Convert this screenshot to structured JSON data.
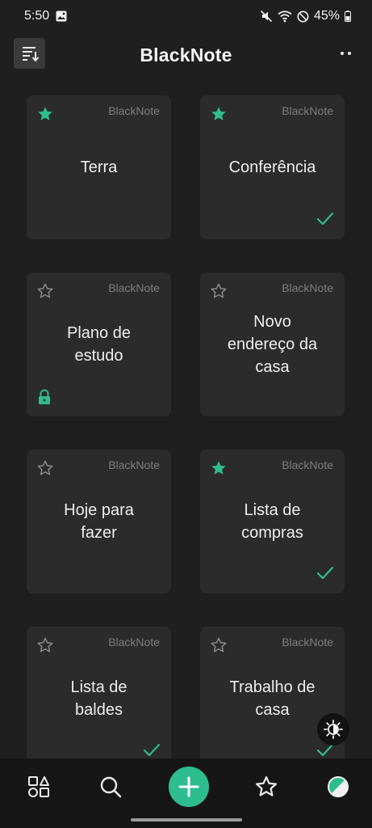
{
  "status": {
    "time": "5:50",
    "battery": "45%"
  },
  "app": {
    "title": "BlackNote"
  },
  "colors": {
    "accent": "#2ebd8f",
    "background": "#1f1f1f",
    "card": "#2b2b2b"
  },
  "notes": [
    {
      "title": "Terra",
      "brand": "BlackNote",
      "starred": true,
      "checked": false,
      "locked": false
    },
    {
      "title": "Conferência",
      "brand": "BlackNote",
      "starred": true,
      "checked": true,
      "locked": false
    },
    {
      "title": "Plano de\nestudo",
      "brand": "BlackNote",
      "starred": false,
      "checked": false,
      "locked": true
    },
    {
      "title": "Novo\nendereço da\ncasa",
      "brand": "BlackNote",
      "starred": false,
      "checked": false,
      "locked": false
    },
    {
      "title": "Hoje para\nfazer",
      "brand": "BlackNote",
      "starred": false,
      "checked": false,
      "locked": false
    },
    {
      "title": "Lista de\ncompras",
      "brand": "BlackNote",
      "starred": true,
      "checked": true,
      "locked": false
    },
    {
      "title": "Lista de\nbaldes",
      "brand": "BlackNote",
      "starred": false,
      "checked": true,
      "locked": false
    },
    {
      "title": "Trabalho de\ncasa",
      "brand": "BlackNote",
      "starred": false,
      "checked": true,
      "locked": false
    }
  ],
  "icons": {
    "sort": "sort-icon",
    "more": "more-icon",
    "categories": "shapes-icon",
    "search": "search-icon",
    "add": "plus-icon",
    "favorites": "star-icon",
    "theme": "theme-icon",
    "brightness": "brightness-icon"
  }
}
